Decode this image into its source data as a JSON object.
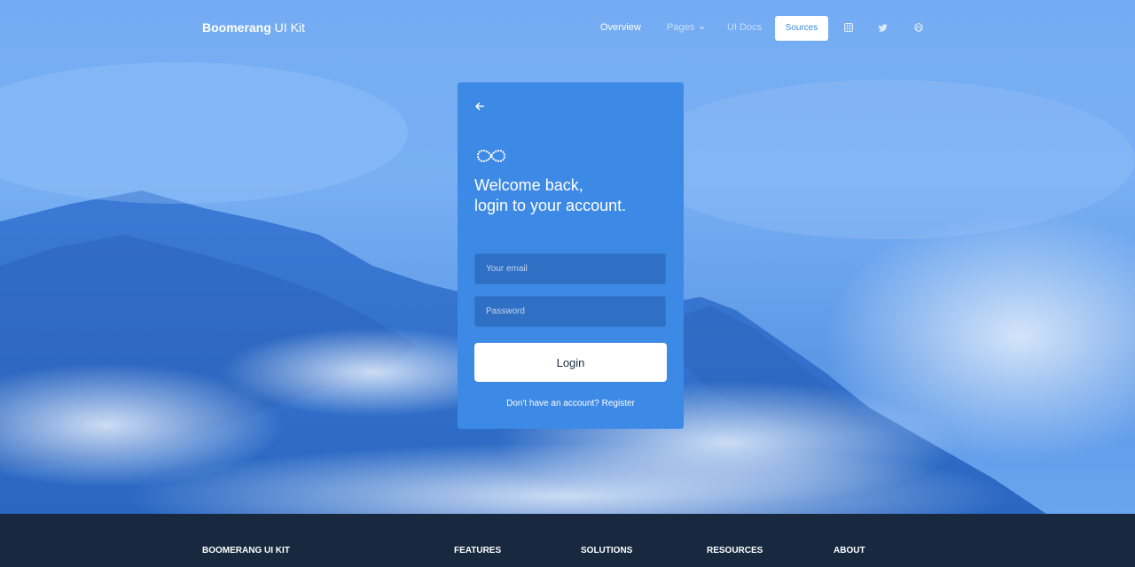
{
  "navbar": {
    "brand_bold": "Boomerang",
    "brand_rest": " UI Kit",
    "items": [
      {
        "label": "Overview"
      },
      {
        "label": "Pages"
      },
      {
        "label": "UI Docs"
      }
    ],
    "sources_label": "Sources",
    "icons": [
      "slack-icon",
      "twitter-icon",
      "github-icon"
    ]
  },
  "login": {
    "heading_line1": "Welcome back,",
    "heading_line2": "login to your account.",
    "email_placeholder": "Your email",
    "password_placeholder": "Password",
    "login_label": "Login",
    "register_text": "Don't have an account? Register",
    "icons": [
      "arrow-left-icon",
      "infinity-logo-icon"
    ]
  },
  "footer": {
    "brand": "BOOMERANG UI KIT",
    "columns": [
      "FEATURES",
      "SOLUTIONS",
      "RESOURCES",
      "ABOUT"
    ]
  },
  "colors": {
    "hero_blue": "#74acf3",
    "card_blue": "#3d89e6",
    "input_blue": "#2f6fc4",
    "footer_navy": "#18293f"
  }
}
